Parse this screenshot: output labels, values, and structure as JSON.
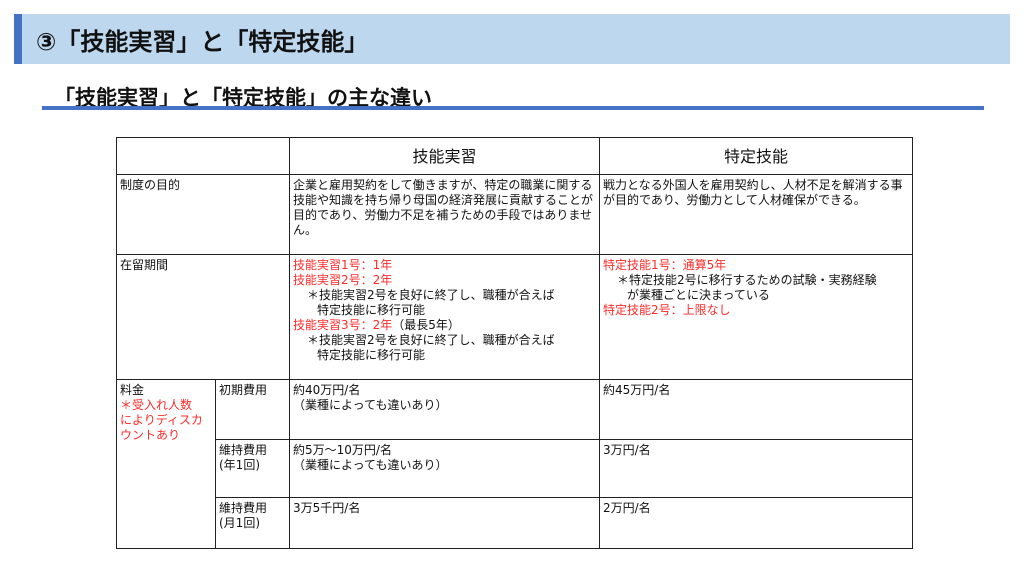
{
  "header": {
    "title": "③「技能実習」と「特定技能」",
    "subtitle": "「技能実習」と「特定技能」の主な違い"
  },
  "table": {
    "columns": [
      "",
      "技能実習",
      "特定技能"
    ],
    "purpose": {
      "label": "制度の目的",
      "ginou_jisshu": "企業と雇用契約をして働きますが、特定の職業に関する技能や知識を持ち帰り母国の経済発展に貢献することが目的であり、労働力不足を補うための手段ではありません。",
      "tokutei_ginou": "戦力となる外国人を雇用契約し、人材不足を解消する事が目的であり、労働力として人材確保ができる。"
    },
    "stay_period": {
      "label": "在留期間",
      "ginou_jisshu": {
        "line1": "技能実習1号：1年",
        "line2": "技能実習2号：2年",
        "note1_a": "＊技能実習2号を良好に終了し、職種が合えば",
        "note1_b": "特定技能に移行可能",
        "line3": "技能実習3号：2年",
        "line3_suffix": "（最長5年）",
        "note2_a": "＊技能実習2号を良好に終了し、職種が合えば",
        "note2_b": "特定技能に移行可能"
      },
      "tokutei_ginou": {
        "line1": "特定技能1号：通算5年",
        "note_a": "＊特定技能2号に移行するための試験・実務経験",
        "note_b": "が業種ごとに決まっている",
        "line2": "特定技能2号：上限なし"
      }
    },
    "fees": {
      "label": "料金",
      "note_lines": [
        "＊受入れ人数",
        "によりディスカ",
        "ウントあり"
      ],
      "rows": [
        {
          "label_lines": [
            "初期費用"
          ],
          "ginou_jisshu_lines": [
            "約40万円/名",
            "（業種によっても違いあり）"
          ],
          "tokutei_ginou": "約45万円/名"
        },
        {
          "label_lines": [
            "維持費用",
            "(年1回)"
          ],
          "ginou_jisshu_lines": [
            "約5万～10万円/名",
            "（業種によっても違いあり）"
          ],
          "tokutei_ginou": "3万円/名"
        },
        {
          "label_lines": [
            "維持費用",
            "(月1回)"
          ],
          "ginou_jisshu_lines": [
            "3万5千円/名"
          ],
          "tokutei_ginou": "2万円/名"
        }
      ]
    }
  },
  "colors": {
    "accent_blue": "#4472c4",
    "title_bg": "#bdd7ee",
    "highlight_red": "#ff2a2a"
  }
}
